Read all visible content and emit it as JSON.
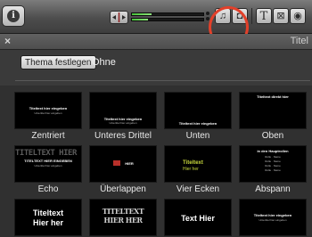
{
  "toolbar": {
    "info_icon": "info-icon",
    "audio_icon": "audio-skimming-icon",
    "meter": {
      "left_level": 0.28,
      "right_level": 0.22
    },
    "tools": [
      {
        "name": "music-icon",
        "glyph": "♫"
      },
      {
        "name": "camera-icon",
        "glyph": "◘"
      },
      {
        "name": "text-icon",
        "glyph": "T"
      },
      {
        "name": "transition-icon",
        "glyph": "⊠"
      },
      {
        "name": "globe-icon",
        "glyph": "◉"
      }
    ],
    "highlight_color": "#e2402a"
  },
  "panel": {
    "close_label": "×",
    "title": "Titel"
  },
  "theme": {
    "button_label": "Thema festlegen",
    "current": "Ohne"
  },
  "tiles": [
    {
      "caption": "Zentriert",
      "thumb": {
        "main": "Titeltext hier eingeben",
        "sub": "Untertitel hier eingeben"
      }
    },
    {
      "caption": "Unteres Drittel",
      "thumb": {
        "main": "Titeltext hier eingeben",
        "sub": "Untertitel hier eingeben"
      }
    },
    {
      "caption": "Unten",
      "thumb": {
        "main": "Titeltext hier eingeben",
        "sub": ""
      }
    },
    {
      "caption": "Oben",
      "thumb": {
        "main": "Titeltext direkt hier",
        "sub": ""
      }
    },
    {
      "caption": "Echo",
      "thumb": {
        "main": "TITELTEXT HIER EINGEBEN",
        "sub": "Untertitel hier eingeben"
      }
    },
    {
      "caption": "Überlappen",
      "thumb": {
        "main": "HIER",
        "sub": ""
      }
    },
    {
      "caption": "Vier Ecken",
      "thumb": {
        "main": "Titeltext",
        "sub": "Hier her"
      }
    },
    {
      "caption": "Abspann",
      "thumb": {
        "main": "in den Hauptrollen",
        "sub": "Rolle · Name"
      }
    },
    {
      "caption": "",
      "thumb": {
        "main": "Titeltext",
        "sub": "Hier her"
      }
    },
    {
      "caption": "",
      "thumb": {
        "main": "TITELTEXT",
        "sub": "HIER HER"
      }
    },
    {
      "caption": "",
      "thumb": {
        "main": "Text Hier",
        "sub": ""
      }
    },
    {
      "caption": "",
      "thumb": {
        "main": "Titeltext hier eingeben",
        "sub": "Untertitel hier eingeben"
      }
    }
  ]
}
